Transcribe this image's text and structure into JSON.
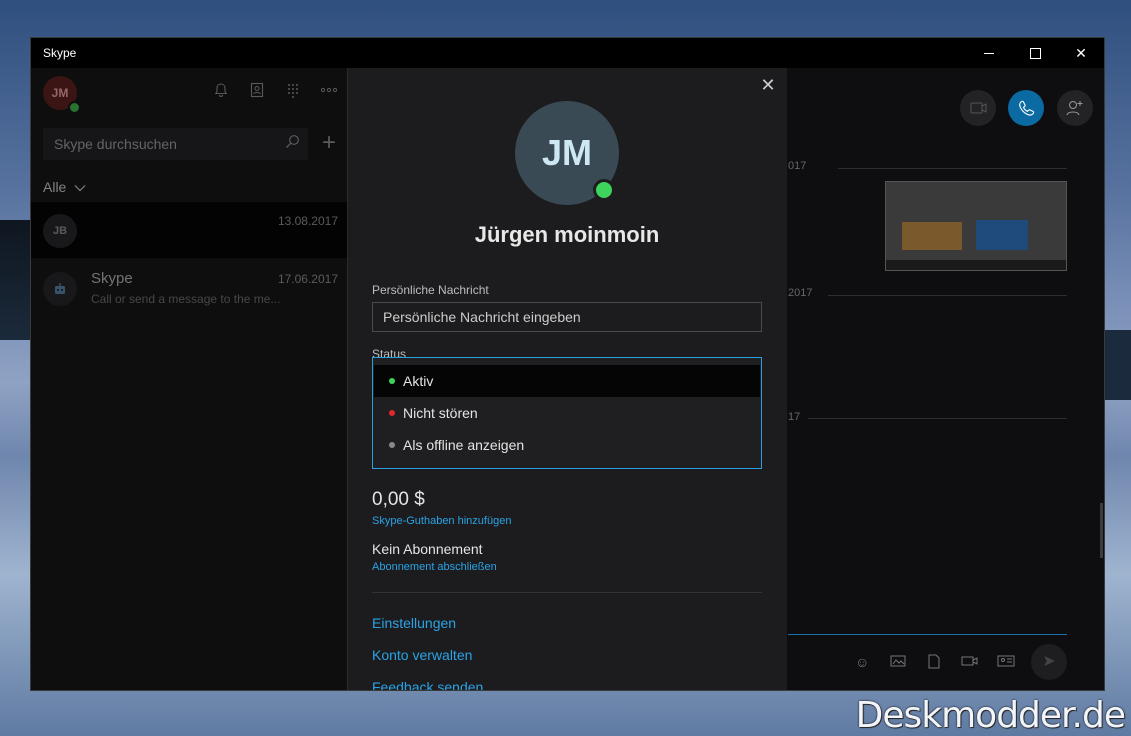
{
  "window": {
    "title": "Skype"
  },
  "user": {
    "initials": "JM",
    "name": "Jürgen moinmoin"
  },
  "sidebar": {
    "search_placeholder": "Skype durchsuchen",
    "filter_label": "Alle",
    "conversations": [
      {
        "initials": "JB",
        "name": "",
        "date": "13.08.2017",
        "preview": ""
      },
      {
        "initials": "",
        "name": "Skype",
        "date": "17.06.2017",
        "preview": "Call or send a message to the me..."
      }
    ]
  },
  "chat": {
    "date_fragments": [
      "017",
      "2017",
      "17"
    ]
  },
  "profile": {
    "personal_message_label": "Persönliche Nachricht",
    "personal_message_placeholder": "Persönliche Nachricht eingeben",
    "status_label": "Status",
    "status_options": [
      {
        "label": "Aktiv",
        "color": "#3ed35c"
      },
      {
        "label": "Nicht stören",
        "color": "#e0262e"
      },
      {
        "label": "Als offline anzeigen",
        "color": "#8a8a8a"
      }
    ],
    "balance": "0,00 $",
    "add_credit_link": "Skype-Guthaben hinzufügen",
    "subscription": "Kein Abonnement",
    "subscribe_link": "Abonnement abschließen",
    "links": [
      "Einstellungen",
      "Konto verwalten",
      "Feedback senden"
    ]
  },
  "watermark": "Deskmodder.de",
  "colors": {
    "accent": "#2aa3e6",
    "online": "#3ed35c",
    "call": "#0b6aa2"
  },
  "icons": {
    "notifications": "bell-icon",
    "contacts": "contacts-icon",
    "dialpad": "dialpad-icon",
    "more": "more-icon",
    "search": "search-icon",
    "new_chat": "plus-icon",
    "close": "close-icon"
  }
}
